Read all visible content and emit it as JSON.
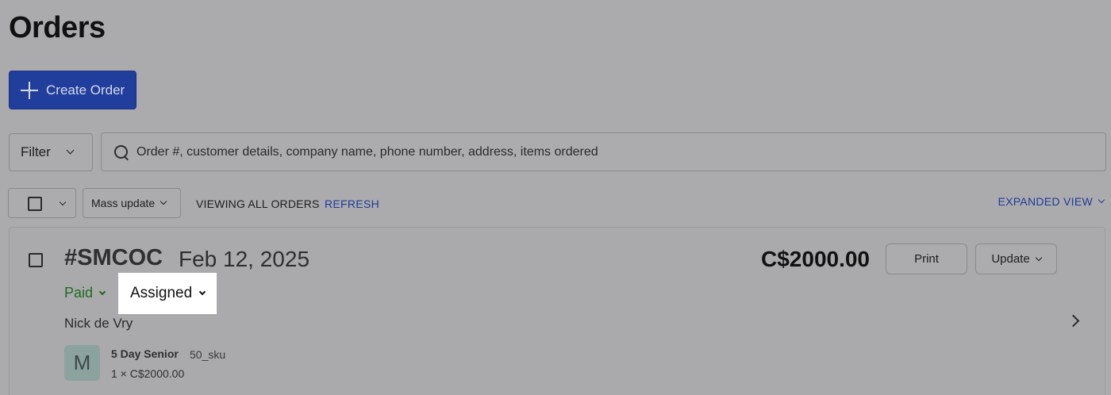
{
  "page": {
    "title": "Orders"
  },
  "toolbar": {
    "create_label": "Create Order",
    "filter_label": "Filter",
    "search_placeholder": "Order #, customer details, company name, phone number, address, items ordered"
  },
  "list_controls": {
    "mass_update_label": "Mass update",
    "viewing_label": "VIEWING ALL ORDERS",
    "refresh_label": "REFRESH",
    "expanded_view_label": "EXPANDED VIEW"
  },
  "orders": [
    {
      "id": "#SMCOC",
      "date": "Feb 12, 2025",
      "total": "C$2000.00",
      "print_label": "Print",
      "update_label": "Update",
      "payment_status": "Paid",
      "fulfillment_status": "Assigned",
      "customer": "Nick de Vry",
      "items": [
        {
          "avatar_letter": "M",
          "name": "5 Day Senior",
          "sku": "50_sku",
          "qty_price": "1 × C$2000.00"
        }
      ]
    }
  ],
  "colors": {
    "primary": "#213e9c",
    "link": "#1f3a96",
    "paid": "#1e6a1e",
    "overlay_bg": "#ababae"
  },
  "icons": [
    "plus-icon",
    "search-icon",
    "chevron-down-icon",
    "chevron-right-icon",
    "checkbox-icon"
  ]
}
